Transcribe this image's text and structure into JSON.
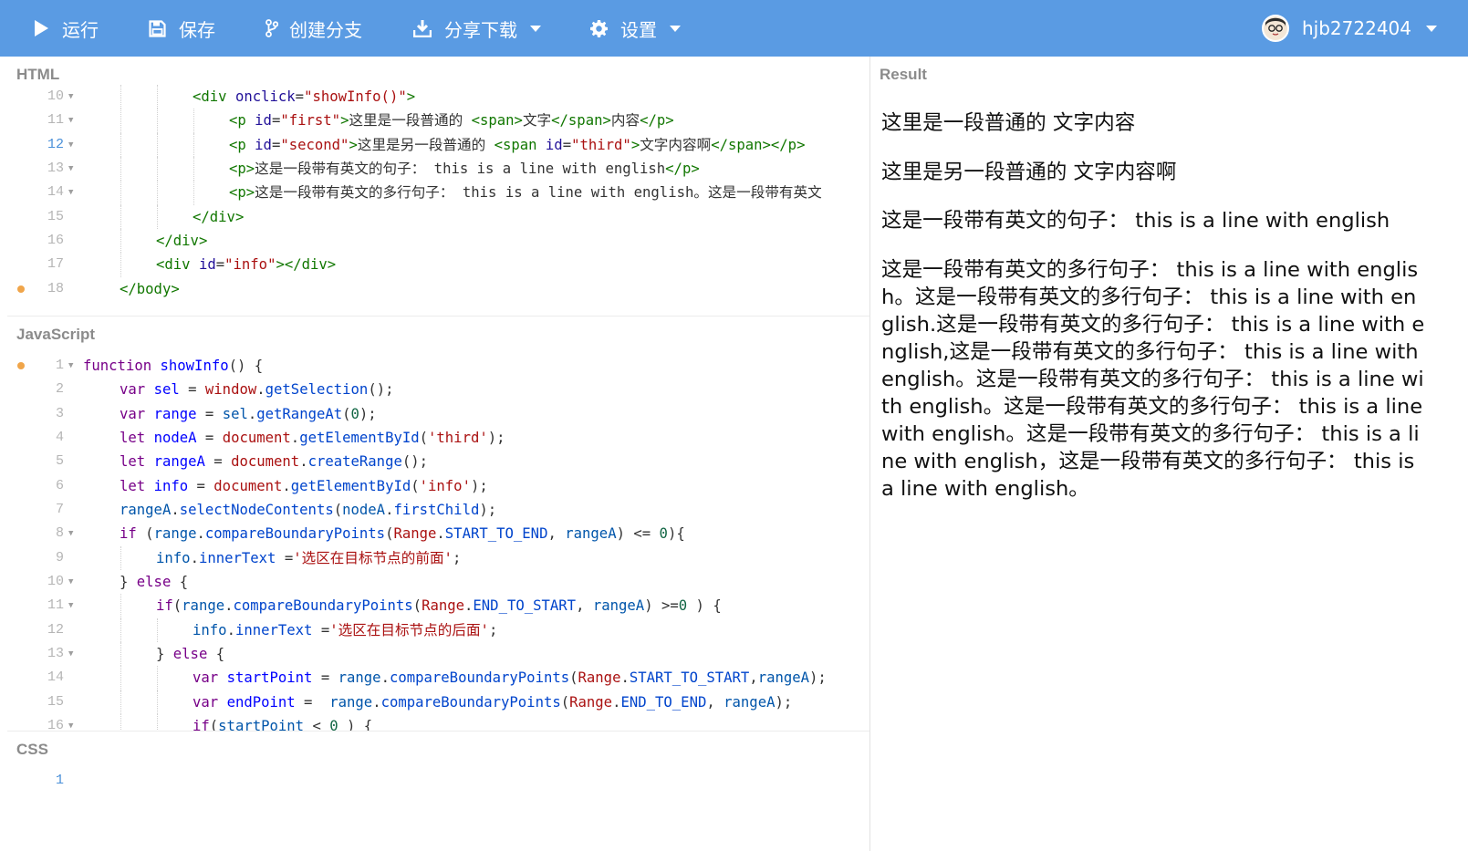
{
  "toolbar": {
    "run": "运行",
    "save": "保存",
    "branch": "创建分支",
    "share": "分享下载",
    "settings": "设置",
    "username": "hjb2722404"
  },
  "panels": {
    "html": "HTML",
    "javascript": "JavaScript",
    "css": "CSS",
    "result": "Result"
  },
  "result": {
    "p1": "这里是一段普通的 文字内容",
    "p2": "这里是另一段普通的 文字内容啊",
    "p3": "这是一段带有英文的句子： this is a line with english",
    "p4": "这是一段带有英文的多行句子： this is a line with english。这是一段带有英文的多行句子： this is a line with english.这是一段带有英文的多行句子： this is a line with english,这是一段带有英文的多行句子： this is a line with english。这是一段带有英文的多行句子： this is a line with english。这是一段带有英文的多行句子： this is a line with english。这是一段带有英文的多行句子： this is a line with english，这是一段带有英文的多行句子： this is a line with english。"
  },
  "html_lines": [
    {
      "n": "10",
      "fold": true,
      "indent": 3,
      "tokens": [
        [
          "t-tag",
          "<div "
        ],
        [
          "t-attr",
          "onclick"
        ],
        [
          "",
          "="
        ],
        [
          "t-str",
          "\"showInfo()\""
        ],
        [
          "t-tag",
          ">"
        ]
      ]
    },
    {
      "n": "11",
      "fold": true,
      "indent": 4,
      "tokens": [
        [
          "t-tag",
          "<p "
        ],
        [
          "t-attr",
          "id"
        ],
        [
          "",
          "="
        ],
        [
          "t-str",
          "\"first\""
        ],
        [
          "t-tag",
          ">"
        ],
        [
          "",
          "这里是一段普通的 "
        ],
        [
          "t-tag",
          "<span>"
        ],
        [
          "",
          "文字"
        ],
        [
          "t-tag",
          "</span>"
        ],
        [
          "",
          "内容"
        ],
        [
          "t-tag",
          "</p>"
        ]
      ]
    },
    {
      "n": "12",
      "fold": true,
      "active": true,
      "indent": 4,
      "tokens": [
        [
          "t-tag",
          "<p "
        ],
        [
          "t-attr",
          "id"
        ],
        [
          "",
          "="
        ],
        [
          "t-str",
          "\"second\""
        ],
        [
          "t-tag",
          ">"
        ],
        [
          "",
          "这里是另一段普通的 "
        ],
        [
          "t-tag",
          "<span "
        ],
        [
          "t-attr",
          "id"
        ],
        [
          "",
          "="
        ],
        [
          "t-str",
          "\"third\""
        ],
        [
          "t-tag",
          ">"
        ],
        [
          "",
          "文字内容啊"
        ],
        [
          "t-tag",
          "</span></p>"
        ]
      ]
    },
    {
      "n": "13",
      "fold": true,
      "indent": 4,
      "tokens": [
        [
          "t-tag",
          "<p>"
        ],
        [
          "",
          "这是一段带有英文的句子： this is a line with english"
        ],
        [
          "t-tag",
          "</p>"
        ]
      ]
    },
    {
      "n": "14",
      "fold": true,
      "indent": 4,
      "tokens": [
        [
          "t-tag",
          "<p>"
        ],
        [
          "",
          "这是一段带有英文的多行句子： this is a line with english。这是一段带有英文"
        ]
      ]
    },
    {
      "n": "15",
      "indent": 3,
      "tokens": [
        [
          "t-tag",
          "</div>"
        ]
      ]
    },
    {
      "n": "16",
      "indent": 2,
      "tokens": [
        [
          "t-tag",
          "</div>"
        ]
      ]
    },
    {
      "n": "17",
      "indent": 2,
      "tokens": [
        [
          "t-tag",
          "<div "
        ],
        [
          "t-attr",
          "id"
        ],
        [
          "",
          "="
        ],
        [
          "t-str",
          "\"info\""
        ],
        [
          "t-tag",
          "></div>"
        ]
      ]
    },
    {
      "n": "18",
      "dot": true,
      "indent": 1,
      "tokens": [
        [
          "t-tag",
          "</body>"
        ]
      ]
    }
  ],
  "js_lines": [
    {
      "n": "1",
      "fold": true,
      "dot": true,
      "indent": 0,
      "tokens": [
        [
          "t-kw",
          "function "
        ],
        [
          "t-def",
          "showInfo"
        ],
        [
          "",
          "() {"
        ]
      ]
    },
    {
      "n": "2",
      "indent": 1,
      "tokens": [
        [
          "t-kw",
          "var "
        ],
        [
          "t-def",
          "sel"
        ],
        [
          "",
          " = "
        ],
        [
          "t-glob",
          "window"
        ],
        [
          "",
          "."
        ],
        [
          "t-prop",
          "getSelection"
        ],
        [
          "",
          "();"
        ]
      ]
    },
    {
      "n": "3",
      "indent": 1,
      "tokens": [
        [
          "t-kw",
          "var "
        ],
        [
          "t-def",
          "range"
        ],
        [
          "",
          " = "
        ],
        [
          "t-var",
          "sel"
        ],
        [
          "",
          "."
        ],
        [
          "t-prop",
          "getRangeAt"
        ],
        [
          "",
          "("
        ],
        [
          "t-num",
          "0"
        ],
        [
          "",
          ");"
        ]
      ]
    },
    {
      "n": "4",
      "indent": 1,
      "tokens": [
        [
          "t-kw",
          "let "
        ],
        [
          "t-def",
          "nodeA"
        ],
        [
          "",
          " = "
        ],
        [
          "t-glob",
          "document"
        ],
        [
          "",
          "."
        ],
        [
          "t-prop",
          "getElementById"
        ],
        [
          "",
          "("
        ],
        [
          "t-str",
          "'third'"
        ],
        [
          "",
          ");"
        ]
      ]
    },
    {
      "n": "5",
      "indent": 1,
      "tokens": [
        [
          "t-kw",
          "let "
        ],
        [
          "t-def",
          "rangeA"
        ],
        [
          "",
          " = "
        ],
        [
          "t-glob",
          "document"
        ],
        [
          "",
          "."
        ],
        [
          "t-prop",
          "createRange"
        ],
        [
          "",
          "();"
        ]
      ]
    },
    {
      "n": "6",
      "indent": 1,
      "tokens": [
        [
          "t-kw",
          "let "
        ],
        [
          "t-def",
          "info"
        ],
        [
          "",
          " = "
        ],
        [
          "t-glob",
          "document"
        ],
        [
          "",
          "."
        ],
        [
          "t-prop",
          "getElementById"
        ],
        [
          "",
          "("
        ],
        [
          "t-str",
          "'info'"
        ],
        [
          "",
          ");"
        ]
      ]
    },
    {
      "n": "7",
      "indent": 1,
      "tokens": [
        [
          "t-var",
          "rangeA"
        ],
        [
          "",
          "."
        ],
        [
          "t-prop",
          "selectNodeContents"
        ],
        [
          "",
          "("
        ],
        [
          "t-var",
          "nodeA"
        ],
        [
          "",
          "."
        ],
        [
          "t-prop",
          "firstChild"
        ],
        [
          "",
          ");"
        ]
      ]
    },
    {
      "n": "8",
      "fold": true,
      "indent": 1,
      "tokens": [
        [
          "t-kw",
          "if "
        ],
        [
          "",
          "("
        ],
        [
          "t-var",
          "range"
        ],
        [
          "",
          "."
        ],
        [
          "t-prop",
          "compareBoundaryPoints"
        ],
        [
          "",
          "("
        ],
        [
          "t-glob",
          "Range"
        ],
        [
          "",
          "."
        ],
        [
          "t-prop",
          "START_TO_END"
        ],
        [
          "",
          ", "
        ],
        [
          "t-var",
          "rangeA"
        ],
        [
          "",
          ") <= "
        ],
        [
          "t-num",
          "0"
        ],
        [
          "",
          "){"
        ]
      ]
    },
    {
      "n": "9",
      "indent": 2,
      "tokens": [
        [
          "t-var",
          "info"
        ],
        [
          "",
          "."
        ],
        [
          "t-prop",
          "innerText"
        ],
        [
          "",
          " ="
        ],
        [
          "t-str",
          "'选区在目标节点的前面'"
        ],
        [
          "",
          ";"
        ]
      ]
    },
    {
      "n": "10",
      "fold": true,
      "indent": 1,
      "tokens": [
        [
          "",
          "} "
        ],
        [
          "t-kw",
          "else "
        ],
        [
          "",
          "{"
        ]
      ]
    },
    {
      "n": "11",
      "fold": true,
      "indent": 2,
      "tokens": [
        [
          "t-kw",
          "if"
        ],
        [
          "",
          "("
        ],
        [
          "t-var",
          "range"
        ],
        [
          "",
          "."
        ],
        [
          "t-prop",
          "compareBoundaryPoints"
        ],
        [
          "",
          "("
        ],
        [
          "t-glob",
          "Range"
        ],
        [
          "",
          "."
        ],
        [
          "t-prop",
          "END_TO_START"
        ],
        [
          "",
          ", "
        ],
        [
          "t-var",
          "rangeA"
        ],
        [
          "",
          ") >="
        ],
        [
          "t-num",
          "0"
        ],
        [
          "",
          " ) {"
        ]
      ]
    },
    {
      "n": "12",
      "indent": 3,
      "tokens": [
        [
          "t-var",
          "info"
        ],
        [
          "",
          "."
        ],
        [
          "t-prop",
          "innerText"
        ],
        [
          "",
          " ="
        ],
        [
          "t-str",
          "'选区在目标节点的后面'"
        ],
        [
          "",
          ";"
        ]
      ]
    },
    {
      "n": "13",
      "fold": true,
      "indent": 2,
      "tokens": [
        [
          "",
          "} "
        ],
        [
          "t-kw",
          "else "
        ],
        [
          "",
          "{"
        ]
      ]
    },
    {
      "n": "14",
      "indent": 3,
      "tokens": [
        [
          "t-kw",
          "var "
        ],
        [
          "t-def",
          "startPoint"
        ],
        [
          "",
          " = "
        ],
        [
          "t-var",
          "range"
        ],
        [
          "",
          "."
        ],
        [
          "t-prop",
          "compareBoundaryPoints"
        ],
        [
          "",
          "("
        ],
        [
          "t-glob",
          "Range"
        ],
        [
          "",
          "."
        ],
        [
          "t-prop",
          "START_TO_START"
        ],
        [
          "",
          ","
        ],
        [
          "t-var",
          "rangeA"
        ],
        [
          "",
          ");"
        ]
      ]
    },
    {
      "n": "15",
      "indent": 3,
      "tokens": [
        [
          "t-kw",
          "var "
        ],
        [
          "t-def",
          "endPoint"
        ],
        [
          "",
          " =  "
        ],
        [
          "t-var",
          "range"
        ],
        [
          "",
          "."
        ],
        [
          "t-prop",
          "compareBoundaryPoints"
        ],
        [
          "",
          "("
        ],
        [
          "t-glob",
          "Range"
        ],
        [
          "",
          "."
        ],
        [
          "t-prop",
          "END_TO_END"
        ],
        [
          "",
          ", "
        ],
        [
          "t-var",
          "rangeA"
        ],
        [
          "",
          ");"
        ]
      ]
    },
    {
      "n": "16",
      "fold": true,
      "indent": 3,
      "tokens": [
        [
          "t-kw",
          "if"
        ],
        [
          "",
          "("
        ],
        [
          "t-var",
          "startPoint"
        ],
        [
          "",
          " < "
        ],
        [
          "t-num",
          "0"
        ],
        [
          "",
          " ) {"
        ]
      ]
    }
  ],
  "css_lines": [
    {
      "n": "1",
      "active": true,
      "indent": 0,
      "tokens": []
    }
  ],
  "colors": {
    "toolbar": "#5a9be3",
    "modified_dot": "#f0a54a"
  }
}
